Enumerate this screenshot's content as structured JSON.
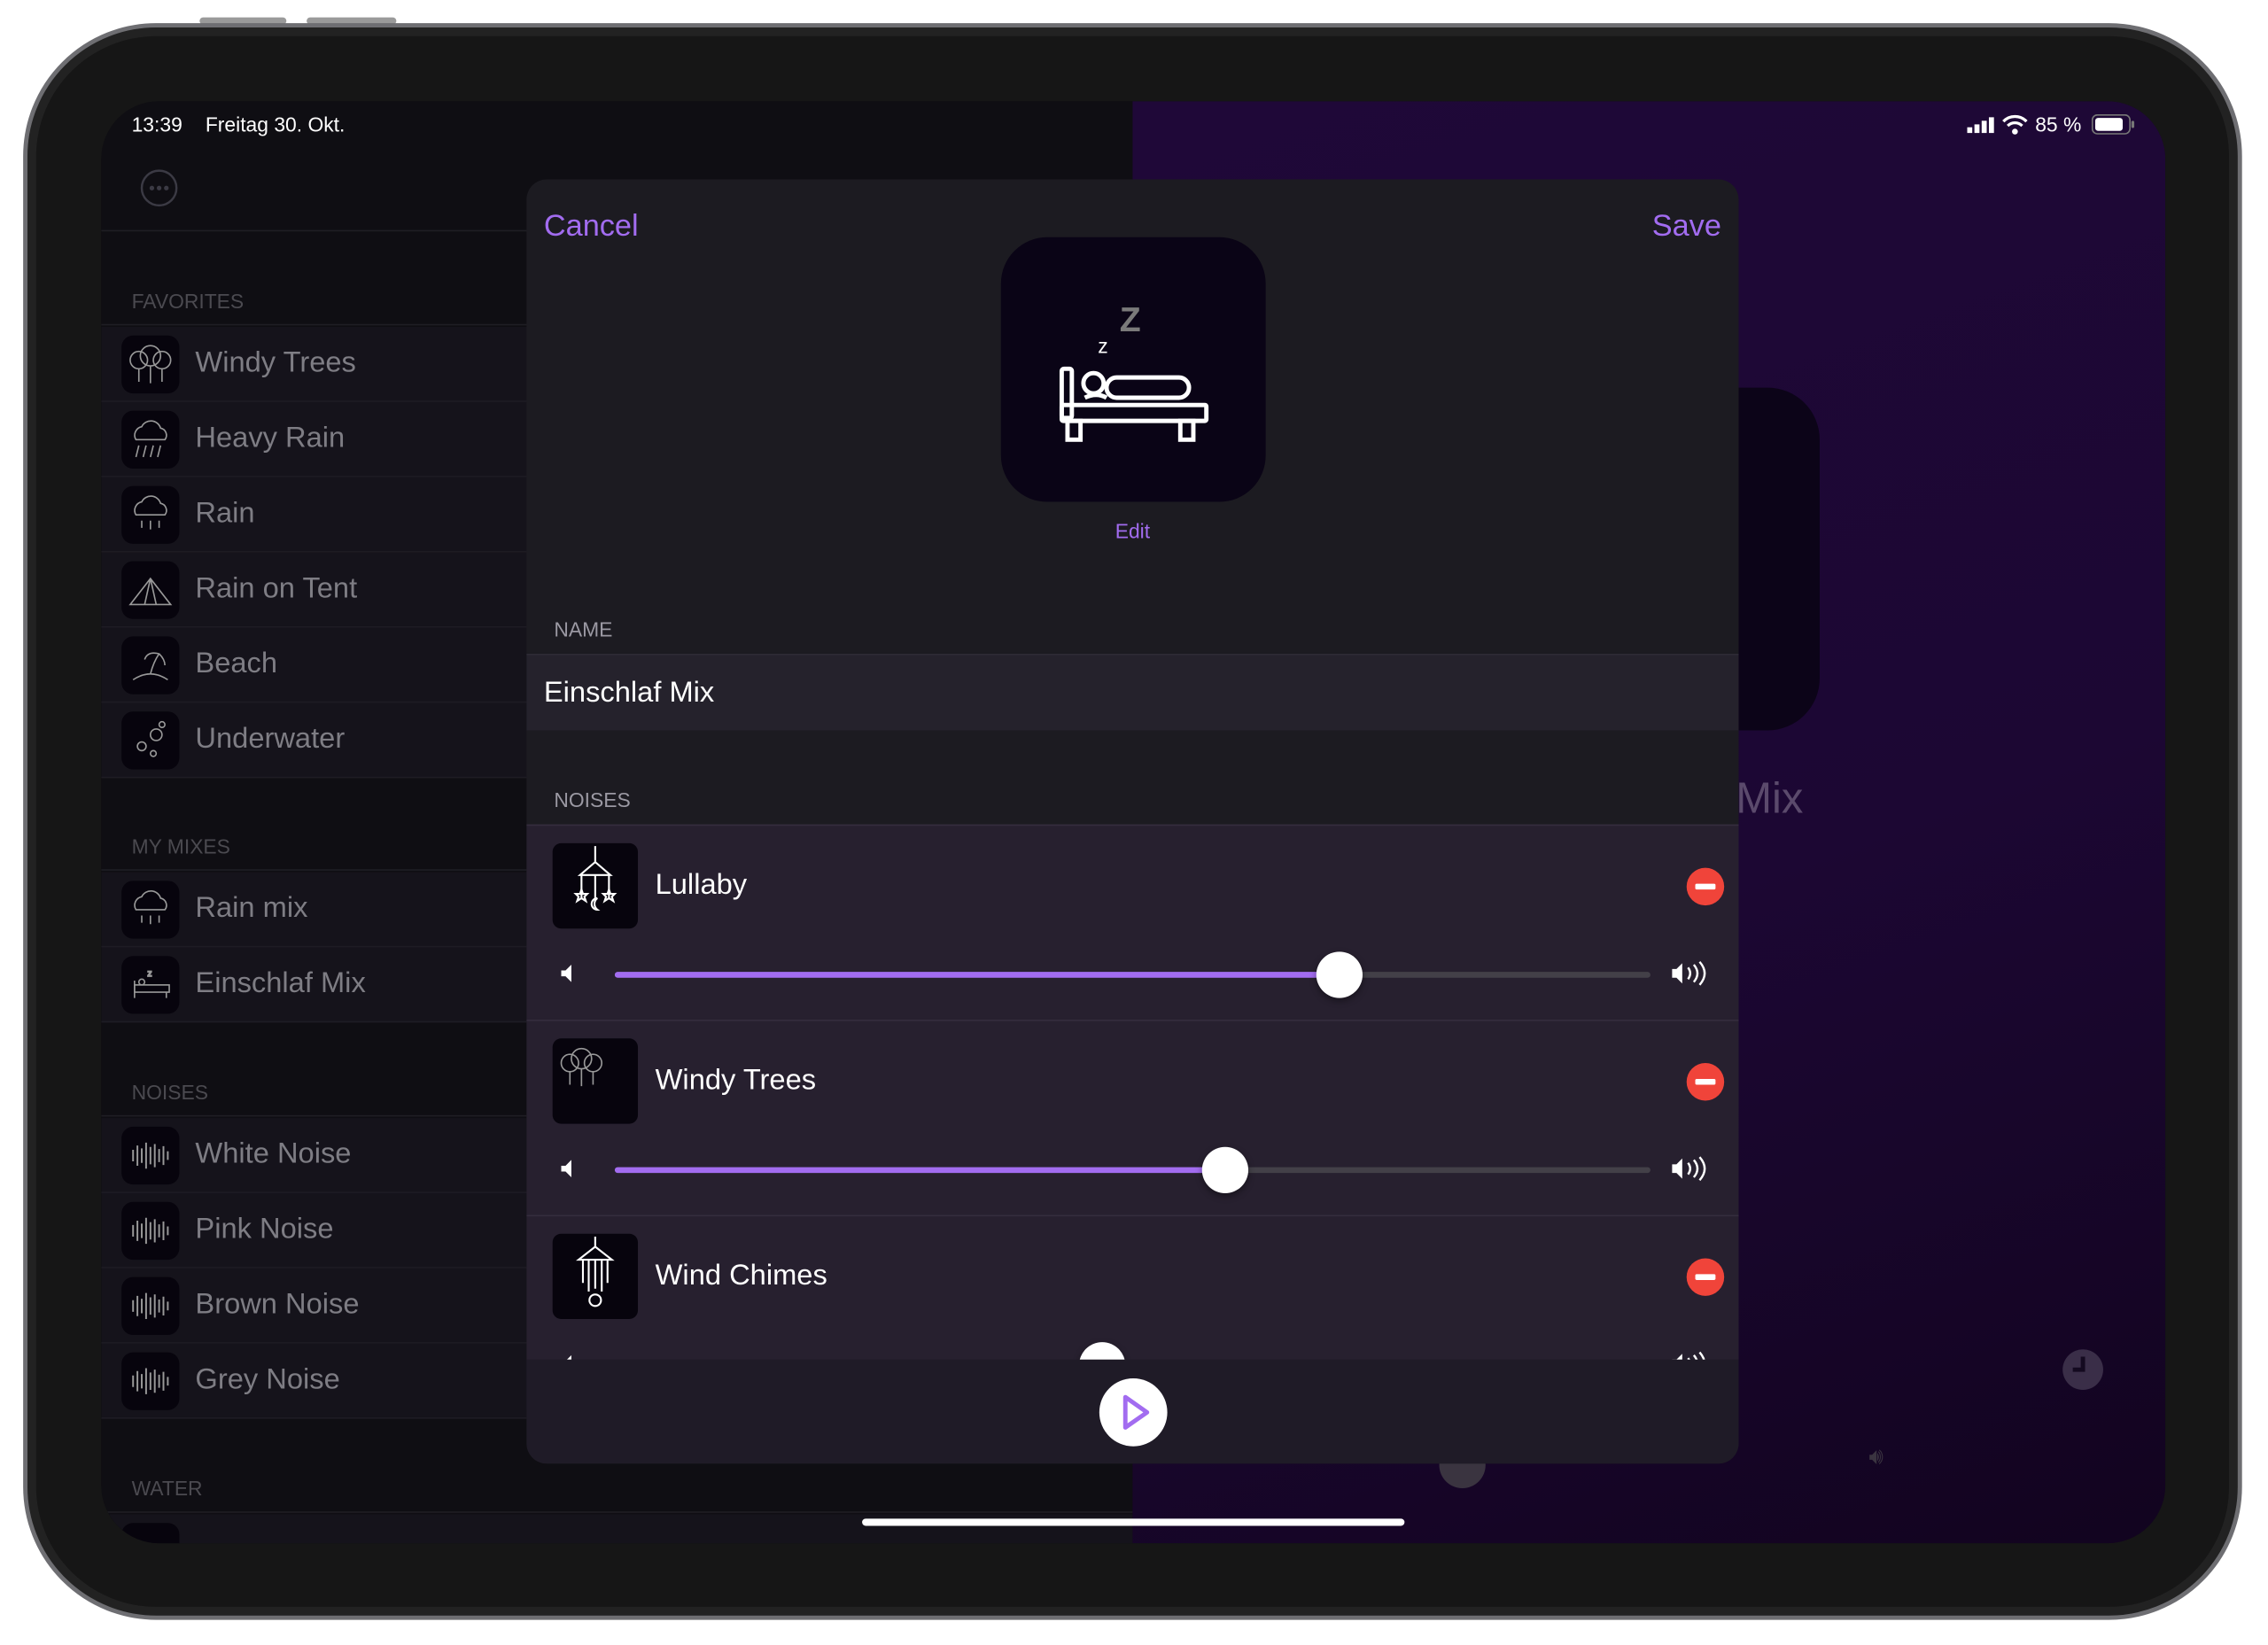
{
  "status_bar": {
    "time": "13:39",
    "date": "Freitag 30. Okt.",
    "battery": "85 %",
    "battery_level": 0.85
  },
  "colors": {
    "accent": "#a26cf0",
    "destructive": "#f0443a",
    "background_right": "#1f0838"
  },
  "sidebar": {
    "more_icon": "ellipsis-circle-icon",
    "sections": [
      {
        "title": "FAVORITES",
        "items": [
          {
            "label": "Windy Trees",
            "icon": "trees-icon"
          },
          {
            "label": "Heavy Rain",
            "icon": "heavy-rain-icon"
          },
          {
            "label": "Rain",
            "icon": "rain-icon"
          },
          {
            "label": "Rain on Tent",
            "icon": "tent-icon"
          },
          {
            "label": "Beach",
            "icon": "beach-icon"
          },
          {
            "label": "Underwater",
            "icon": "bubbles-icon"
          }
        ]
      },
      {
        "title": "MY MIXES",
        "items": [
          {
            "label": "Rain mix",
            "icon": "rain-icon"
          },
          {
            "label": "Einschlaf Mix",
            "icon": "bed-icon"
          }
        ]
      },
      {
        "title": "NOISES",
        "items": [
          {
            "label": "White Noise",
            "icon": "waveform-icon"
          },
          {
            "label": "Pink Noise",
            "icon": "waveform-icon"
          },
          {
            "label": "Brown Noise",
            "icon": "waveform-icon"
          },
          {
            "label": "Grey Noise",
            "icon": "waveform-icon"
          }
        ]
      },
      {
        "title": "WATER",
        "items": []
      }
    ]
  },
  "detail": {
    "title_fragment": "Mix"
  },
  "modal": {
    "cancel": "Cancel",
    "save": "Save",
    "edit": "Edit",
    "artwork_icon": "sleeping-bed-icon",
    "name_label": "NAME",
    "name_value": "Einschlaf Mix",
    "noises_label": "NOISES",
    "noises": [
      {
        "name": "Lullaby",
        "icon": "baby-mobile-icon",
        "volume": 0.7
      },
      {
        "name": "Windy Trees",
        "icon": "trees-icon",
        "volume": 0.59
      },
      {
        "name": "Wind Chimes",
        "icon": "wind-chimes-icon",
        "volume": 0.47
      }
    ]
  }
}
